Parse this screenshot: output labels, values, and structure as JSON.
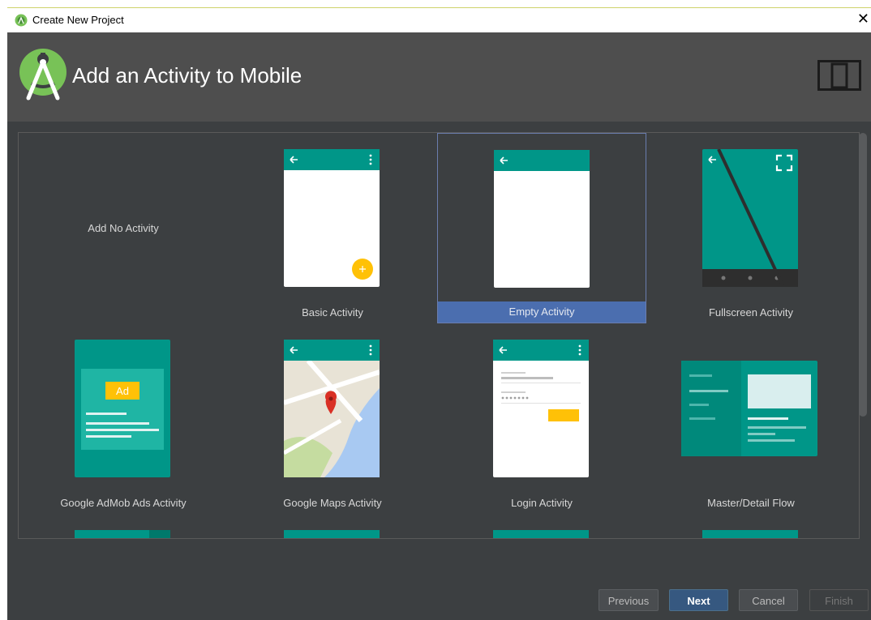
{
  "window": {
    "title": "Create New Project",
    "close_symbol": "✕"
  },
  "header": {
    "title": "Add an Activity to Mobile"
  },
  "activities": [
    {
      "label": "Add No Activity",
      "selected": false
    },
    {
      "label": "Basic Activity",
      "selected": false
    },
    {
      "label": "Empty Activity",
      "selected": true
    },
    {
      "label": "Fullscreen Activity",
      "selected": false
    },
    {
      "label": "Google AdMob Ads Activity",
      "selected": false
    },
    {
      "label": "Google Maps Activity",
      "selected": false
    },
    {
      "label": "Login Activity",
      "selected": false
    },
    {
      "label": "Master/Detail Flow",
      "selected": false
    }
  ],
  "ad_badge": "Ad",
  "buttons": {
    "previous": "Previous",
    "next": "Next",
    "cancel": "Cancel",
    "finish": "Finish"
  },
  "colors": {
    "teal": "#009688",
    "teal_dark": "#00796b",
    "accent": "#ffc107",
    "selection": "#4b6eaf"
  }
}
